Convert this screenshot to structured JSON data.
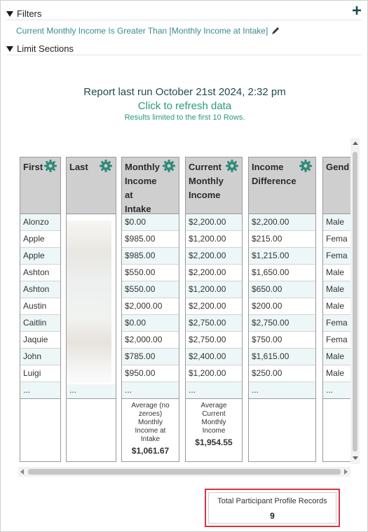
{
  "filters": {
    "title": "Filters",
    "condition": "Current Monthly Income Is Greater Than [Monthly Income at Intake]",
    "add_icon": "plus-icon",
    "edit_icon": "pencil-icon"
  },
  "limit_sections": {
    "title": "Limit Sections"
  },
  "report": {
    "last_run": "Report last run October 21st 2024, 2:32 pm",
    "refresh": "Click to refresh data",
    "limit_note": "Results limited to the first 10 Rows."
  },
  "columns": [
    {
      "header": "First",
      "cells": [
        "Alonzo",
        "Apple",
        "Apple",
        "Ashton",
        "Ashton",
        "Austin",
        "Caitlin",
        "Jaquie",
        "John",
        "Luigi",
        "..."
      ],
      "footer": "",
      "footer_value": ""
    },
    {
      "header": "Last",
      "cells": [
        "",
        "",
        "",
        "",
        "",
        "",
        "",
        "",
        "",
        "",
        "..."
      ],
      "footer": "",
      "footer_value": ""
    },
    {
      "header": "Monthly Income at Intake",
      "cells": [
        "$0.00",
        "$985.00",
        "$985.00",
        "$550.00",
        "$550.00",
        "$2,000.00",
        "$0.00",
        "$2,000.00",
        "$785.00",
        "$950.00",
        "..."
      ],
      "footer": "Average (no zeroes) Monthly Income at Intake",
      "footer_value": "$1,061.67"
    },
    {
      "header": "Current Monthly Income",
      "cells": [
        "$2,200.00",
        "$1,200.00",
        "$2,200.00",
        "$2,200.00",
        "$1,200.00",
        "$2,200.00",
        "$2,750.00",
        "$2,750.00",
        "$2,400.00",
        "$1,200.00",
        "..."
      ],
      "footer": "Average Current Monthly Income",
      "footer_value": "$1,954.55"
    },
    {
      "header": "Income Difference",
      "cells": [
        "$2,200.00",
        "$215.00",
        "$1,215.00",
        "$1,650.00",
        "$650.00",
        "$200.00",
        "$2,750.00",
        "$750.00",
        "$1,615.00",
        "$250.00",
        "..."
      ],
      "footer": "",
      "footer_value": ""
    },
    {
      "header": "Gend",
      "cells": [
        "Male",
        "Fema",
        "Fema",
        "Male",
        "Male",
        "Male",
        "Fema",
        "Fema",
        "Male",
        "Male",
        "..."
      ],
      "footer": "",
      "footer_value": ""
    }
  ],
  "total": {
    "label": "Total Participant Profile Records",
    "value": "9"
  },
  "colors": {
    "accent": "#2a9a7a",
    "header_bg": "#cfcfcf",
    "highlight": "#d9353e"
  }
}
